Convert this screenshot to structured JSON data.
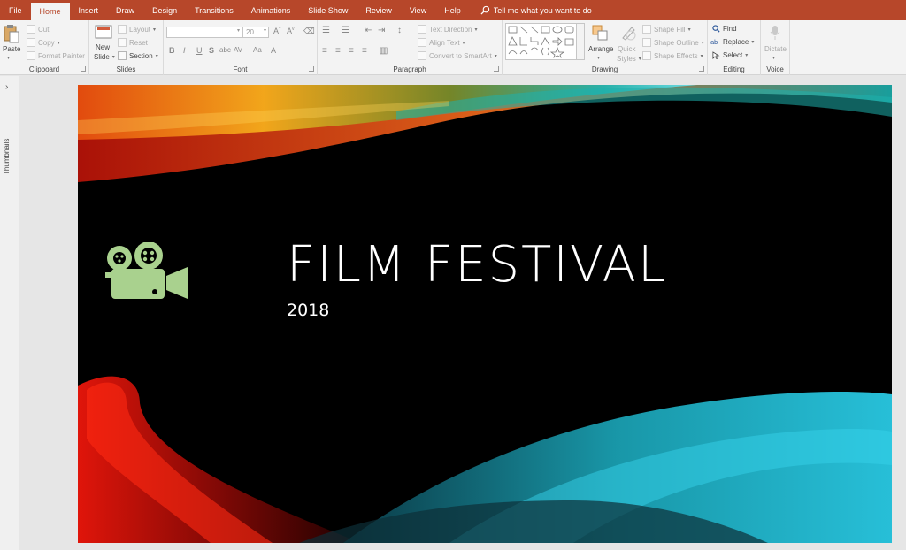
{
  "tabs": [
    "File",
    "Home",
    "Insert",
    "Draw",
    "Design",
    "Transitions",
    "Animations",
    "Slide Show",
    "Review",
    "View",
    "Help"
  ],
  "active_tab": "Home",
  "tell_me": "Tell me what you want to do",
  "ribbon": {
    "clipboard": {
      "label": "Clipboard",
      "paste": "Paste",
      "cut": "Cut",
      "copy": "Copy",
      "format_painter": "Format Painter"
    },
    "slides": {
      "label": "Slides",
      "new_slide_1": "New",
      "new_slide_2": "Slide",
      "layout": "Layout",
      "reset": "Reset",
      "section": "Section"
    },
    "font": {
      "label": "Font",
      "font_name": "",
      "font_size": "20",
      "bold": "B",
      "italic": "I",
      "underline": "U",
      "shadow": "S",
      "strike": "abc",
      "spacing": "AV",
      "case": "Aa",
      "color": "A"
    },
    "paragraph": {
      "label": "Paragraph",
      "text_direction": "Text Direction",
      "align_text": "Align Text",
      "convert_smartart": "Convert to SmartArt"
    },
    "drawing": {
      "label": "Drawing",
      "arrange": "Arrange",
      "quick_styles_1": "Quick",
      "quick_styles_2": "Styles",
      "shape_fill": "Shape Fill",
      "shape_outline": "Shape Outline",
      "shape_effects": "Shape Effects"
    },
    "editing": {
      "label": "Editing",
      "find": "Find",
      "replace": "Replace",
      "select": "Select"
    },
    "voice": {
      "label": "Voice",
      "dictate": "Dictate"
    }
  },
  "thumbnails_label": "Thumbnails",
  "slide": {
    "title": "FILM FESTIVAL",
    "subtitle": "2018",
    "icon": "film-camera-icon",
    "icon_color": "#a9d18e"
  },
  "colors": {
    "accent": "#b7472a",
    "ribbon_bg": "#f3f3f3"
  }
}
